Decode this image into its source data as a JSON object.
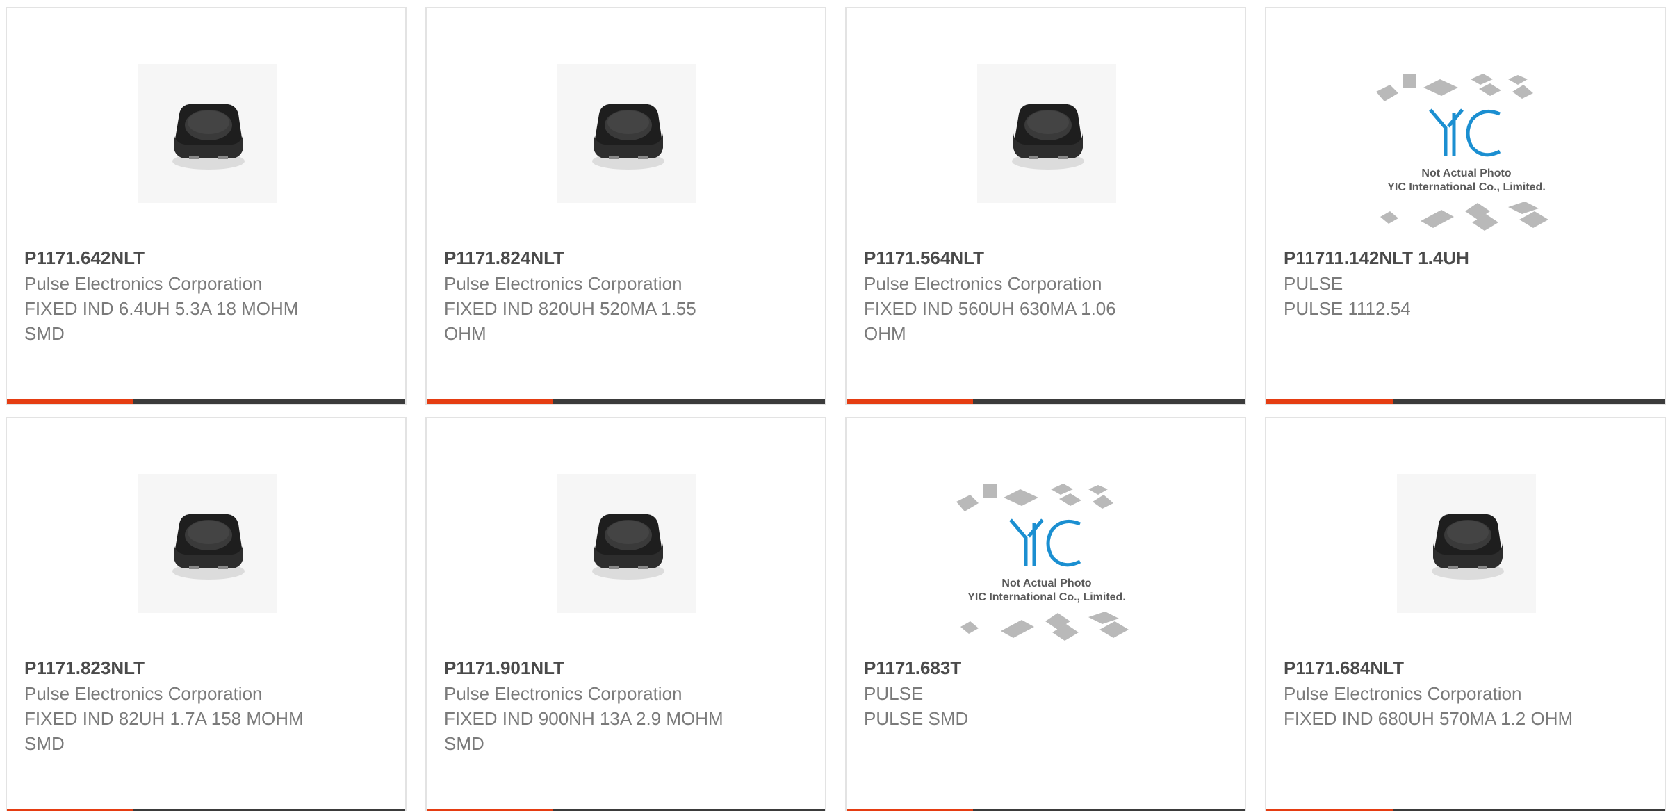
{
  "colors": {
    "accent": "#e53d12",
    "bar_dark": "#3b3b3b",
    "part_number": "#4a4a4a",
    "body_text": "#7a7a7a",
    "card_border": "#e3e3e3",
    "yic_blue": "#1b8fd1"
  },
  "products": [
    {
      "part_number": "P1171.642NLT",
      "manufacturer": "Pulse Electronics Corporation",
      "description": "FIXED IND 6.4UH 5.3A 18 MOHM SMD",
      "image": "inductor-photo"
    },
    {
      "part_number": "P1171.824NLT",
      "manufacturer": "Pulse Electronics Corporation",
      "description": "FIXED IND 820UH 520MA 1.55 OHM",
      "image": "inductor-photo"
    },
    {
      "part_number": "P1171.564NLT",
      "manufacturer": "Pulse Electronics Corporation",
      "description": "FIXED IND 560UH 630MA 1.06 OHM",
      "image": "inductor-photo"
    },
    {
      "part_number": "P11711.142NLT 1.4UH",
      "manufacturer": "PULSE",
      "description": "PULSE 1112.54",
      "image": "placeholder-photo",
      "placeholder_line1": "Not Actual Photo",
      "placeholder_line2": "YIC International Co., Limited."
    },
    {
      "part_number": "P1171.823NLT",
      "manufacturer": "Pulse Electronics Corporation",
      "description": "FIXED IND 82UH 1.7A 158 MOHM SMD",
      "image": "inductor-photo"
    },
    {
      "part_number": "P1171.901NLT",
      "manufacturer": "Pulse Electronics Corporation",
      "description": "FIXED IND 900NH 13A 2.9 MOHM SMD",
      "image": "inductor-photo"
    },
    {
      "part_number": "P1171.683T",
      "manufacturer": "PULSE",
      "description": "PULSE SMD",
      "image": "placeholder-photo",
      "placeholder_line1": "Not Actual Photo",
      "placeholder_line2": "YIC International Co., Limited."
    },
    {
      "part_number": "P1171.684NLT",
      "manufacturer": "Pulse Electronics Corporation",
      "description": "FIXED IND 680UH 570MA 1.2 OHM",
      "image": "inductor-photo"
    }
  ]
}
